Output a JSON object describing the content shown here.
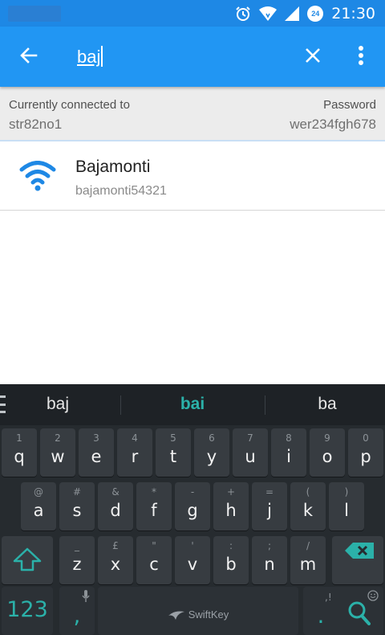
{
  "status_bar": {
    "time": "21:30",
    "badge": "24",
    "icons": [
      "alarm-icon",
      "wifi-signal-icon",
      "cell-signal-icon",
      "data-saver-icon"
    ]
  },
  "app_bar": {
    "search_value": "baj",
    "icons": [
      "arrow-back-icon",
      "close-icon",
      "more-vert-icon"
    ]
  },
  "connection": {
    "connected_label": "Currently connected to",
    "connected_ssid": "str82no1",
    "password_label": "Password",
    "password_value": "wer234fgh678"
  },
  "networks": [
    {
      "name": "Bajamonti",
      "password": "bajamonti54321"
    }
  ],
  "keyboard": {
    "suggestions": [
      "baj",
      "bai",
      "ba"
    ],
    "row1": [
      {
        "k": "q",
        "h": "1"
      },
      {
        "k": "w",
        "h": "2"
      },
      {
        "k": "e",
        "h": "3"
      },
      {
        "k": "r",
        "h": "4"
      },
      {
        "k": "t",
        "h": "5"
      },
      {
        "k": "y",
        "h": "6"
      },
      {
        "k": "u",
        "h": "7"
      },
      {
        "k": "i",
        "h": "8"
      },
      {
        "k": "o",
        "h": "9"
      },
      {
        "k": "p",
        "h": "0"
      }
    ],
    "row2": [
      {
        "k": "a",
        "h": "@"
      },
      {
        "k": "s",
        "h": "#"
      },
      {
        "k": "d",
        "h": "&"
      },
      {
        "k": "f",
        "h": "*"
      },
      {
        "k": "g",
        "h": "-"
      },
      {
        "k": "h",
        "h": "+"
      },
      {
        "k": "j",
        "h": "="
      },
      {
        "k": "k",
        "h": "("
      },
      {
        "k": "l",
        "h": ")"
      }
    ],
    "row3": [
      {
        "k": "z",
        "h": "_"
      },
      {
        "k": "x",
        "h": "£"
      },
      {
        "k": "c",
        "h": "\""
      },
      {
        "k": "v",
        "h": "'"
      },
      {
        "k": "b",
        "h": ":"
      },
      {
        "k": "n",
        "h": ";"
      },
      {
        "k": "m",
        "h": "/"
      }
    ],
    "key_123": "123",
    "key_comma": ",",
    "key_period": ".",
    "period_hint": ",!?",
    "space_brand": "SwiftKey",
    "accent_color": "#2bb1a9",
    "icons": [
      "shift-icon",
      "backspace-icon",
      "mic-icon",
      "emoji-icon",
      "search-icon",
      "menu-icon"
    ]
  }
}
